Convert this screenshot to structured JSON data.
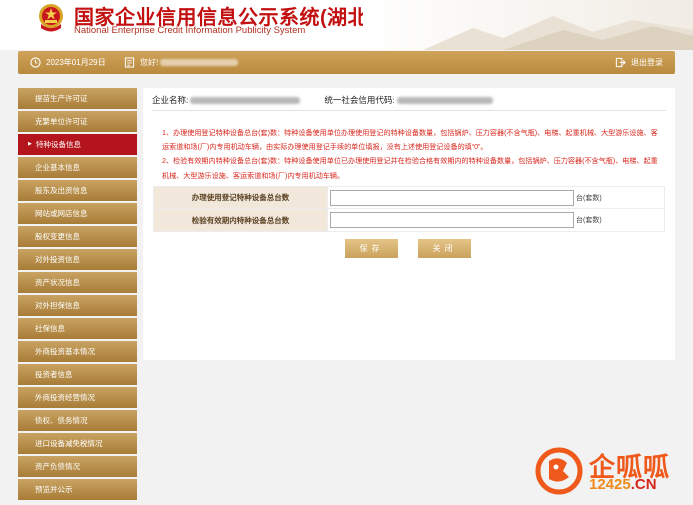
{
  "header": {
    "title_main": "国家企业信用信息公示系统",
    "title_region": "(湖北)",
    "subtitle": "National Enterprise Credit Information Publicity System"
  },
  "userbar": {
    "date": "2023年01月29日",
    "greeting": "您好!",
    "logout": "退出登录"
  },
  "sidebar": {
    "items": [
      {
        "label": "提苗生产许可证",
        "active": false
      },
      {
        "label": "克繁单位许可证",
        "active": false
      },
      {
        "label": "特种设备信息",
        "active": true
      },
      {
        "label": "企业基本信息",
        "active": false
      },
      {
        "label": "股东及出资信息",
        "active": false
      },
      {
        "label": "网站或网店信息",
        "active": false
      },
      {
        "label": "股权变更信息",
        "active": false
      },
      {
        "label": "对外投资信息",
        "active": false
      },
      {
        "label": "资产状况信息",
        "active": false
      },
      {
        "label": "对外担保信息",
        "active": false
      },
      {
        "label": "社保信息",
        "active": false
      },
      {
        "label": "外商投资基本情况",
        "active": false
      },
      {
        "label": "投资者信息",
        "active": false
      },
      {
        "label": "外商投资经营情况",
        "active": false
      },
      {
        "label": "债权、债务情况",
        "active": false
      },
      {
        "label": "进口设备减免税情况",
        "active": false
      },
      {
        "label": "资产负债情况",
        "active": false
      },
      {
        "label": "预览并公示",
        "active": false
      }
    ]
  },
  "main": {
    "company_label": "企业名称:",
    "credit_code_label": "统一社会信用代码:",
    "notice_1": "1、办理使用登记特种设备总台(套)数：特种设备使用单位办理使用登记的特种设备数量，包括锅炉、压力容器(不含气瓶)、电梯、起重机械、大型游乐设施、客运索道和场(厂)内专用机动车辆，由实际办理使用登记手续的单位填报，没有上述使用登记设备的填“0”。",
    "notice_2": "2、检验有效期内特种设备总台(套)数：特种设备使用单位已办理使用登记并在检验合格有效期内的特种设备数量，包括锅炉、压力容器(不含气瓶)、电梯、起重机械、大型游乐设施、客运索道和场(厂)内专用机动车辆。",
    "form": [
      {
        "label": "办理使用登记特种设备总台数",
        "value": "",
        "unit": "台(套数)"
      },
      {
        "label": "检验有效期内特种设备总台数",
        "value": "",
        "unit": "台(套数)"
      }
    ],
    "save_label": "保存",
    "close_label": "关闭"
  },
  "watermark": {
    "brand": "企呱呱",
    "domain_num": "12425",
    "domain_tld": ".CN"
  },
  "colors": {
    "brand_red": "#c21010",
    "gold": "#b98a3e",
    "active_red": "#b4141c",
    "notice_red": "#d9261c",
    "watermark_orange": "#ef5a1c"
  }
}
